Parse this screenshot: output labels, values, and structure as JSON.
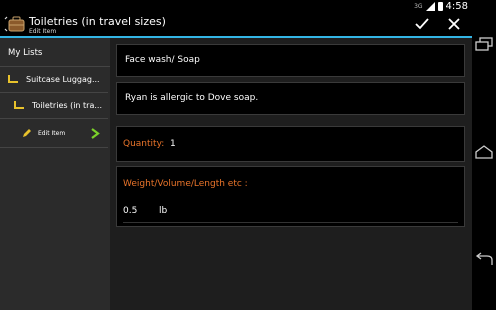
{
  "status": {
    "time": "4:58",
    "signal_label": "3G"
  },
  "actionbar": {
    "title": "Toiletries (in travel sizes)",
    "subtitle": "Edit Item",
    "accent_color": "#33b5e5",
    "check_icon": "checkmark-icon",
    "close_icon": "close-icon"
  },
  "sidebar": {
    "header": "My Lists",
    "items": [
      {
        "label": "Suitcase Luggag...",
        "icon": "folder-corner-icon"
      },
      {
        "label": "Toiletries (in tra...",
        "icon": "folder-corner-icon"
      },
      {
        "label": "Edit Item",
        "icon": "pencil-icon"
      }
    ]
  },
  "form": {
    "name": "Face wash/ Soap",
    "note": "Ryan is allergic to Dove soap.",
    "quantity_label": "Quantity:",
    "quantity_value": "1",
    "measure_label": "Weight/Volume/Length etc :",
    "measure_value": "0.5",
    "measure_unit": "lb",
    "label_color": "#e9742a"
  }
}
